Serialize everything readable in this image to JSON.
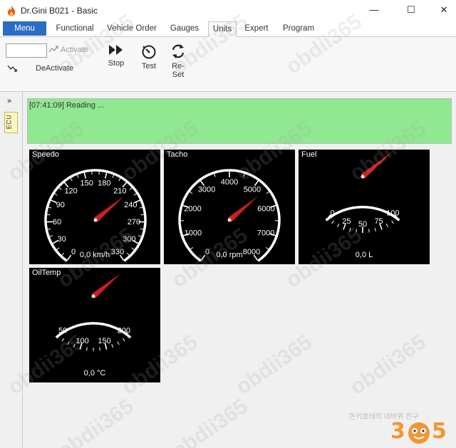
{
  "window": {
    "title": "Dr.Gini B021 - Basic",
    "minimize_glyph": "—",
    "maximize_glyph": "☐",
    "close_glyph": "✕"
  },
  "menubar": {
    "menu_label": "Menu",
    "tabs": [
      "Functional",
      "Vehicle Order",
      "Gauges",
      "Units",
      "Expert",
      "Program"
    ],
    "active_tab": "Units"
  },
  "ribbon": {
    "ecu_input_value": "",
    "activate_label": "Activate",
    "deactivate_label": "DeActivate",
    "stop_label": "Stop",
    "test_label": "Test",
    "reset_label": "Re-Set"
  },
  "side_panel": {
    "expand_glyph": "»",
    "ecu_tab_label": "ECU"
  },
  "status": {
    "text": "[07:41:09] Reading ..."
  },
  "gauges": {
    "speedo": {
      "title": "Speedo",
      "reading": "0,0 km/h",
      "scale": [
        "0",
        "30",
        "60",
        "90",
        "120",
        "150",
        "180",
        "210",
        "240",
        "270",
        "300",
        "330"
      ],
      "value": 0
    },
    "tacho": {
      "title": "Tacho",
      "reading": "0,0 rpm",
      "scale": [
        "0",
        "1000",
        "2000",
        "3000",
        "4000",
        "5000",
        "6000",
        "7000",
        "8000"
      ],
      "value": 0
    },
    "fuel": {
      "title": "Fuel",
      "reading": "0,0 L",
      "scale": [
        "0",
        "25",
        "50",
        "75",
        "100"
      ],
      "value": 0
    },
    "oiltemp": {
      "title": "OilTemp",
      "reading": "0,0 °C",
      "scale": [
        "50",
        "100",
        "150",
        "200"
      ],
      "value": 0
    }
  },
  "watermark": {
    "site_text": "obdii365",
    "korean_text": "돈키호테의 네바퀴 친구",
    "logo_left": "3",
    "logo_right": "5"
  },
  "colors": {
    "menu_blue": "#2b6cc4",
    "status_green": "#90e890",
    "needle_red": "#cc1f1f",
    "gauge_bg": "#000000",
    "logo_orange": "#f29532"
  }
}
